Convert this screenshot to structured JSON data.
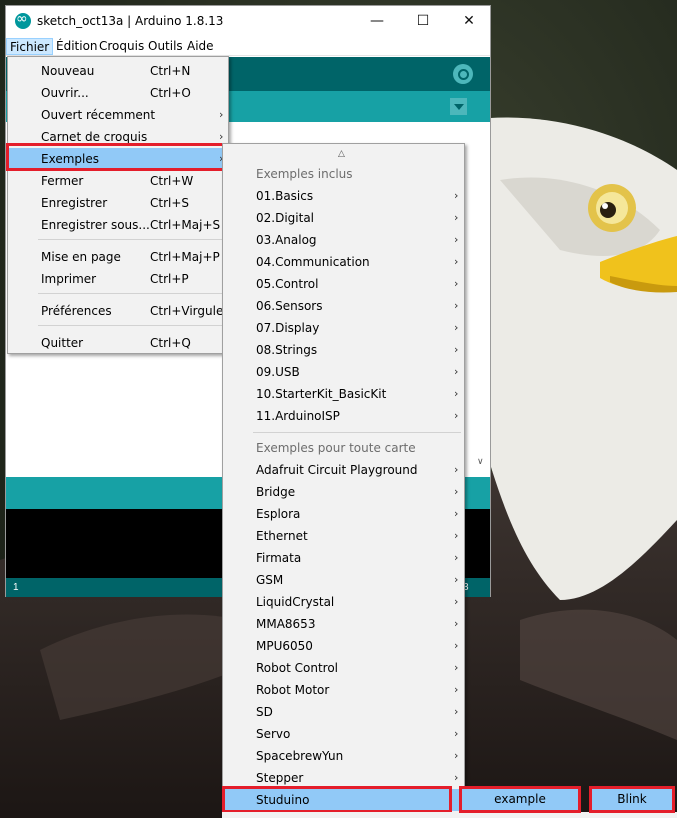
{
  "window": {
    "title": "sketch_oct13a | Arduino 1.8.13",
    "minimize": "—",
    "maximize": "☐",
    "close": "✕"
  },
  "menubar": [
    "Fichier",
    "Édition",
    "Croquis",
    "Outils",
    "Aide"
  ],
  "fichier_menu": {
    "items": [
      {
        "label": "Nouveau",
        "shortcut": "Ctrl+N"
      },
      {
        "label": "Ouvrir...",
        "shortcut": "Ctrl+O"
      },
      {
        "label": "Ouvert récemment",
        "submenu": true
      },
      {
        "label": "Carnet de croquis",
        "submenu": true
      },
      {
        "label": "Exemples",
        "submenu": true,
        "selected": true
      },
      {
        "label": "Fermer",
        "shortcut": "Ctrl+W"
      },
      {
        "label": "Enregistrer",
        "shortcut": "Ctrl+S"
      },
      {
        "label": "Enregistrer sous...",
        "shortcut": "Ctrl+Maj+S"
      },
      {
        "label": "Mise en page",
        "shortcut": "Ctrl+Maj+P"
      },
      {
        "label": "Imprimer",
        "shortcut": "Ctrl+P"
      },
      {
        "label": "Préférences",
        "shortcut": "Ctrl+Virgule"
      },
      {
        "label": "Quitter",
        "shortcut": "Ctrl+Q"
      }
    ]
  },
  "examples_menu": {
    "header_builtin": "Exemples inclus",
    "builtin": [
      "01.Basics",
      "02.Digital",
      "03.Analog",
      "04.Communication",
      "05.Control",
      "06.Sensors",
      "07.Display",
      "08.Strings",
      "09.USB",
      "10.StarterKit_BasicKit",
      "11.ArduinoISP"
    ],
    "header_any_board": "Exemples pour toute carte",
    "any_board": [
      "Adafruit Circuit Playground",
      "Bridge",
      "Esplora",
      "Ethernet",
      "Firmata",
      "GSM",
      "LiquidCrystal",
      "MMA8653",
      "MPU6050",
      "Robot Control",
      "Robot Motor",
      "SD",
      "Servo",
      "SpacebrewYun",
      "Stepper"
    ],
    "selected": "Studuino"
  },
  "studuino_submenu": {
    "selected": "example"
  },
  "example_submenu": {
    "selected": "Blink"
  },
  "footer": {
    "line": "1",
    "port_fragment": "3"
  },
  "icons": {
    "app": "arduino-logo-icon",
    "serial": "serial-monitor-icon",
    "submenu": "chevron-right-icon"
  },
  "colors": {
    "toolbar": "#006468",
    "tabbar": "#17a1a5",
    "highlight": "#91c9f7",
    "annotation": "#e41e2b"
  }
}
